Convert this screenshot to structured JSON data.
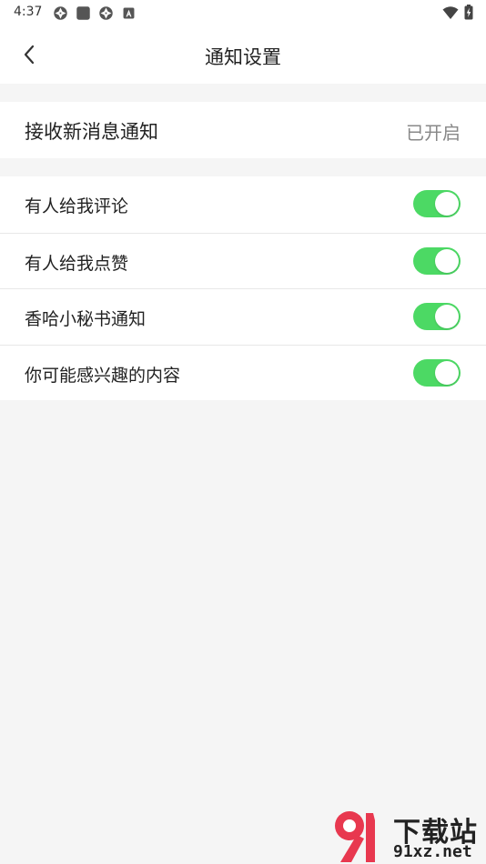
{
  "status_bar": {
    "time": "4:37"
  },
  "nav": {
    "title": "通知设置"
  },
  "master": {
    "label": "接收新消息通知",
    "status": "已开启"
  },
  "settings": [
    {
      "label": "有人给我评论",
      "enabled": true
    },
    {
      "label": "有人给我点赞",
      "enabled": true
    },
    {
      "label": "香哈小秘书通知",
      "enabled": true
    },
    {
      "label": "你可能感兴趣的内容",
      "enabled": true
    }
  ],
  "watermark": {
    "title": "下载站",
    "url": "91xz.net"
  },
  "colors": {
    "toggle_on": "#4cd964",
    "watermark_red": "#e8384f"
  }
}
